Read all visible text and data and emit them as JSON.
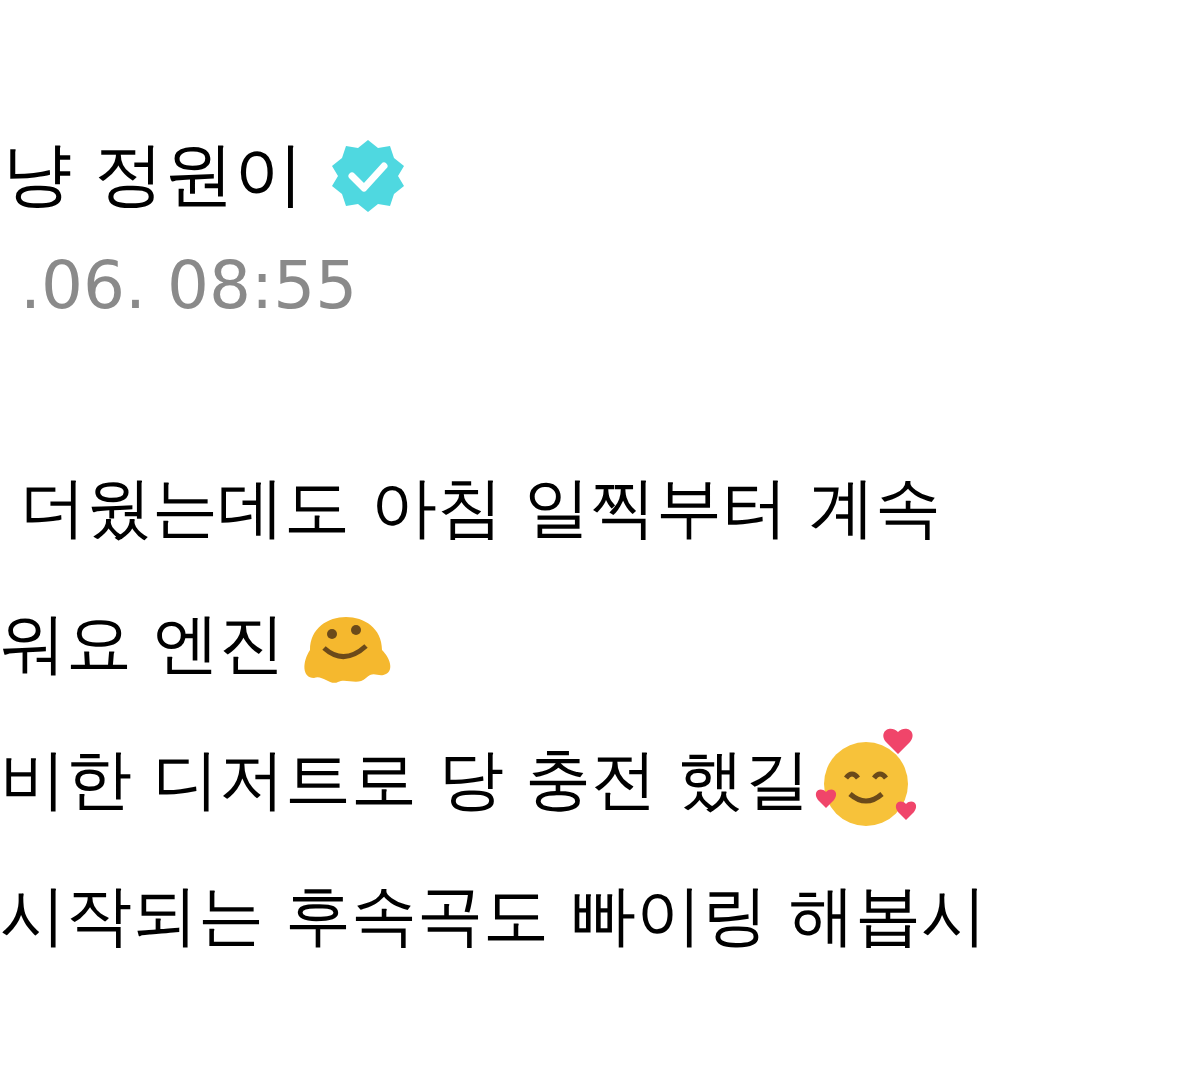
{
  "author": {
    "name": "냥 정원이",
    "verified": true
  },
  "timestamp": ".06. 08:55",
  "body": [
    {
      "text": "더웠는데도 아침 일찍부터 계속",
      "kind": "plain"
    },
    {
      "text": "워요 엔진",
      "kind": "melting"
    },
    {
      "text": "비한 디저트로 당 충전 했길",
      "kind": "hearts"
    },
    {
      "text": "시작되는 후속곡도 빠이링 해봅시",
      "kind": "plain"
    }
  ]
}
